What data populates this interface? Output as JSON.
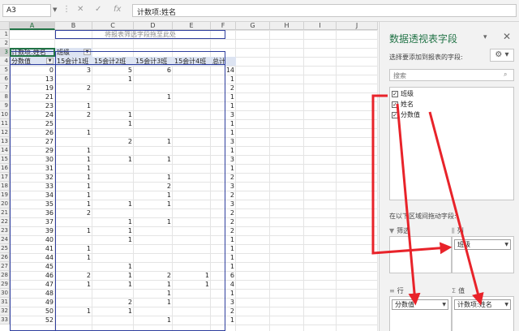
{
  "formula_bar": {
    "cell_ref": "A3",
    "cancel_icon": "✕",
    "confirm_icon": "✓",
    "fx_label": "fx",
    "content": "计数项:姓名"
  },
  "grid": {
    "columns": [
      "A",
      "B",
      "C",
      "D",
      "E",
      "F",
      "G",
      "H",
      "I",
      "J"
    ],
    "rows": [
      "1",
      "2",
      "3",
      "4",
      "5",
      "6",
      "7",
      "8",
      "9",
      "10",
      "11",
      "12",
      "13",
      "14",
      "15",
      "16",
      "17",
      "18",
      "19",
      "20",
      "21",
      "22",
      "23",
      "24",
      "25",
      "26",
      "27",
      "28",
      "29",
      "30",
      "31",
      "32",
      "33"
    ],
    "drop_hint": "将报表筛选字段拖至此处",
    "pivot": {
      "corner_label": "计数项:姓名",
      "col_field_label": "班级",
      "row_field_label": "分数值",
      "col_headers": [
        "15会计1班",
        "15会计2班",
        "15会计3班",
        "15会计4班",
        "总计"
      ],
      "rows": [
        {
          "k": "0",
          "v": [
            "3",
            "5",
            "6",
            "",
            "14"
          ]
        },
        {
          "k": "13",
          "v": [
            "",
            "1",
            "",
            "",
            "1"
          ]
        },
        {
          "k": "19",
          "v": [
            "2",
            "",
            "",
            "",
            "2"
          ]
        },
        {
          "k": "21",
          "v": [
            "",
            "",
            "1",
            "",
            "1"
          ]
        },
        {
          "k": "23",
          "v": [
            "1",
            "",
            "",
            "",
            "1"
          ]
        },
        {
          "k": "24",
          "v": [
            "2",
            "1",
            "",
            "",
            "3"
          ]
        },
        {
          "k": "25",
          "v": [
            "",
            "1",
            "",
            "",
            "1"
          ]
        },
        {
          "k": "26",
          "v": [
            "1",
            "",
            "",
            "",
            "1"
          ]
        },
        {
          "k": "27",
          "v": [
            "",
            "2",
            "1",
            "",
            "3"
          ]
        },
        {
          "k": "29",
          "v": [
            "1",
            "",
            "",
            "",
            "1"
          ]
        },
        {
          "k": "30",
          "v": [
            "1",
            "1",
            "1",
            "",
            "3"
          ]
        },
        {
          "k": "31",
          "v": [
            "1",
            "",
            "",
            "",
            "1"
          ]
        },
        {
          "k": "32",
          "v": [
            "1",
            "",
            "1",
            "",
            "2"
          ]
        },
        {
          "k": "33",
          "v": [
            "1",
            "",
            "2",
            "",
            "3"
          ]
        },
        {
          "k": "34",
          "v": [
            "1",
            "",
            "1",
            "",
            "2"
          ]
        },
        {
          "k": "35",
          "v": [
            "1",
            "1",
            "1",
            "",
            "3"
          ]
        },
        {
          "k": "36",
          "v": [
            "2",
            "",
            "",
            "",
            "2"
          ]
        },
        {
          "k": "37",
          "v": [
            "",
            "1",
            "1",
            "",
            "2"
          ]
        },
        {
          "k": "39",
          "v": [
            "1",
            "1",
            "",
            "",
            "2"
          ]
        },
        {
          "k": "40",
          "v": [
            "",
            "1",
            "",
            "",
            "1"
          ]
        },
        {
          "k": "41",
          "v": [
            "1",
            "",
            "",
            "",
            "1"
          ]
        },
        {
          "k": "44",
          "v": [
            "1",
            "",
            "",
            "",
            "1"
          ]
        },
        {
          "k": "45",
          "v": [
            "",
            "1",
            "",
            "",
            "1"
          ]
        },
        {
          "k": "46",
          "v": [
            "2",
            "1",
            "2",
            "1",
            "6"
          ]
        },
        {
          "k": "47",
          "v": [
            "1",
            "1",
            "1",
            "1",
            "4"
          ]
        },
        {
          "k": "48",
          "v": [
            "",
            "",
            "1",
            "",
            "1"
          ]
        },
        {
          "k": "49",
          "v": [
            "",
            "2",
            "1",
            "",
            "3"
          ]
        },
        {
          "k": "50",
          "v": [
            "1",
            "1",
            "",
            "",
            "2"
          ]
        },
        {
          "k": "52",
          "v": [
            "",
            "",
            "1",
            "",
            "1"
          ]
        }
      ]
    }
  },
  "pane": {
    "title": "数据透视表字段",
    "subtitle": "选择要添加到报表的字段:",
    "search_placeholder": "搜索",
    "fields": [
      {
        "label": "班级",
        "checked": true
      },
      {
        "label": "姓名",
        "checked": true
      },
      {
        "label": "分数值",
        "checked": true
      }
    ],
    "drag_hint": "在以下区域间拖动字段:",
    "zones": {
      "filter": {
        "label": "筛选"
      },
      "columns": {
        "label": "列",
        "item": "班级"
      },
      "rows": {
        "label": "行",
        "item": "分数值"
      },
      "values": {
        "label": "值",
        "item": "计数项:姓名"
      }
    }
  },
  "colors": {
    "accent": "#217346",
    "pivot_border": "#2f3f9e",
    "arrow": "#e8232a"
  }
}
